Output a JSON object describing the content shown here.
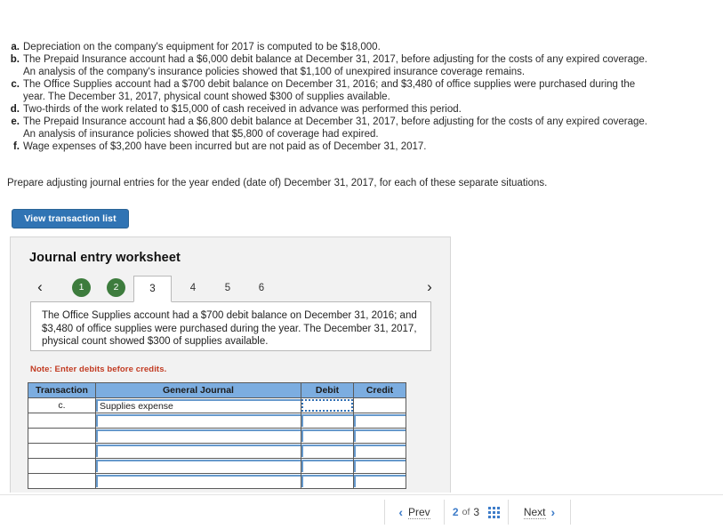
{
  "problem": {
    "items": [
      {
        "letter": "a.",
        "text": "Depreciation on the company's equipment for 2017 is computed to be $18,000."
      },
      {
        "letter": "b.",
        "text": "The Prepaid Insurance account had a $6,000 debit balance at December 31, 2017, before adjusting for the costs of any expired coverage. An analysis of the company's insurance policies showed that $1,100 of unexpired insurance coverage remains."
      },
      {
        "letter": "c.",
        "text": "The Office Supplies account had a $700 debit balance on December 31, 2016; and $3,480 of office supplies were purchased during the year. The December 31, 2017, physical count showed $300 of supplies available."
      },
      {
        "letter": "d.",
        "text": "Two-thirds of the work related to $15,000 of cash received in advance was performed this period."
      },
      {
        "letter": "e.",
        "text": "The Prepaid Insurance account had a $6,800 debit balance at December 31, 2017, before adjusting for the costs of any expired coverage. An analysis of insurance policies showed that $5,800 of coverage had expired."
      },
      {
        "letter": "f.",
        "text": "Wage expenses of $3,200 have been incurred but are not paid as of December 31, 2017."
      }
    ],
    "instruction": "Prepare adjusting journal entries for the year ended (date of) December 31, 2017, for each of these separate situations."
  },
  "toolbar": {
    "view_transaction_list_label": "View transaction list"
  },
  "worksheet": {
    "title": "Journal entry worksheet",
    "tabs": [
      {
        "label": "1",
        "state": "completed"
      },
      {
        "label": "2",
        "state": "completed"
      },
      {
        "label": "3",
        "state": "active"
      },
      {
        "label": "4",
        "state": "pending"
      },
      {
        "label": "5",
        "state": "pending"
      },
      {
        "label": "6",
        "state": "pending"
      }
    ],
    "prev_arrow": "‹",
    "next_arrow": "›",
    "tab_content": "The Office Supplies account had a $700 debit balance on December 31, 2016; and $3,480 of office supplies were purchased during the year. The December 31, 2017, physical count showed $300 of supplies available.",
    "note": "Note: Enter debits before credits.",
    "table": {
      "headers": [
        "Transaction",
        "General Journal",
        "Debit",
        "Credit"
      ],
      "rows": [
        {
          "transaction": "c.",
          "general_journal": "Supplies expense",
          "debit": "",
          "credit": "",
          "debit_selected": true
        },
        {
          "transaction": "",
          "general_journal": "",
          "debit": "",
          "credit": "",
          "debit_selected": false
        },
        {
          "transaction": "",
          "general_journal": "",
          "debit": "",
          "credit": "",
          "debit_selected": false
        },
        {
          "transaction": "",
          "general_journal": "",
          "debit": "",
          "credit": "",
          "debit_selected": false
        },
        {
          "transaction": "",
          "general_journal": "",
          "debit": "",
          "credit": "",
          "debit_selected": false
        },
        {
          "transaction": "",
          "general_journal": "",
          "debit": "",
          "credit": "",
          "debit_selected": false
        }
      ]
    }
  },
  "pagination": {
    "prev_label": "Prev",
    "next_label": "Next",
    "current_page": "2",
    "of_label": "of",
    "total_pages": "3",
    "prev_chevron": "‹",
    "next_chevron": "›"
  },
  "colors": {
    "button_blue": "#3074b4",
    "tab_green": "#3d7c3d",
    "table_header_blue": "#7cade0",
    "note_red": "#c23b22",
    "link_blue": "#3d7cc9",
    "panel_gray": "#f2f2f2"
  }
}
